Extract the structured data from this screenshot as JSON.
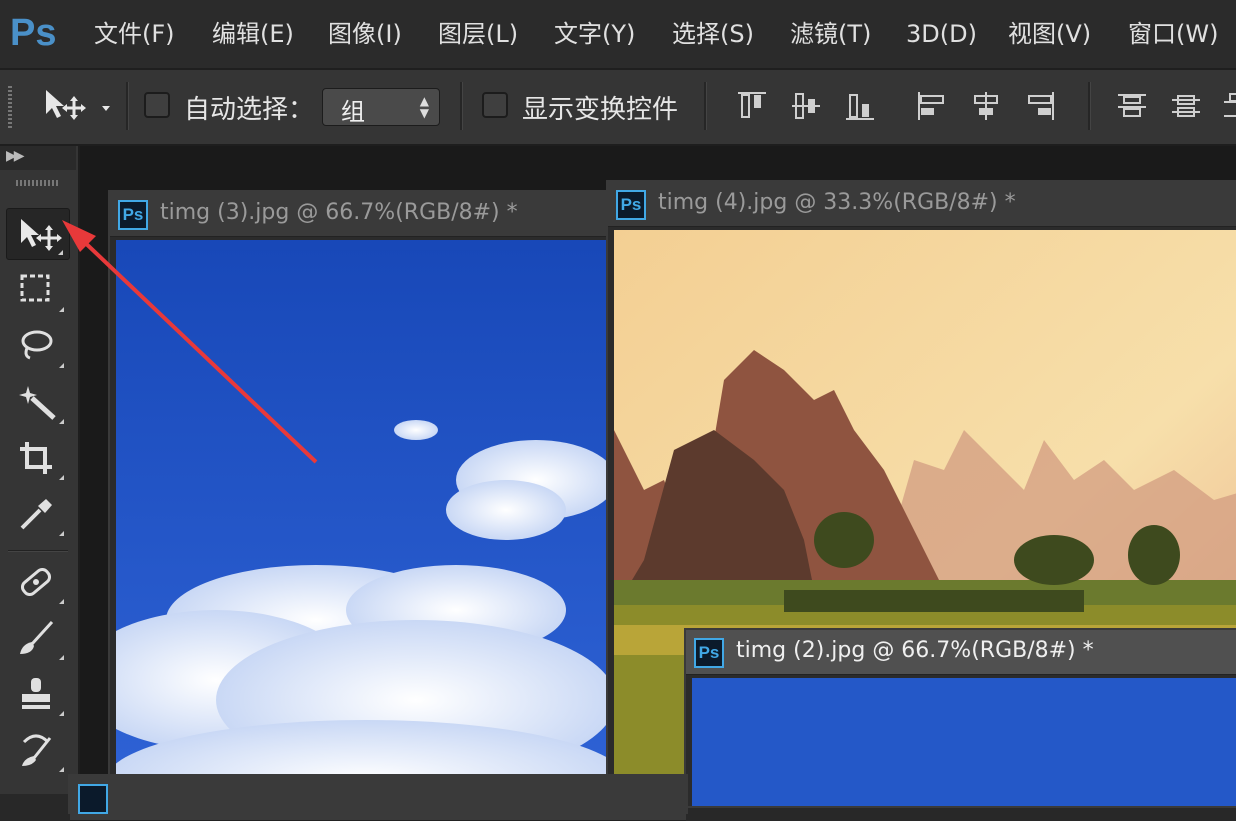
{
  "app": {
    "logo": "Ps"
  },
  "menu": [
    "文件(F)",
    "编辑(E)",
    "图像(I)",
    "图层(L)",
    "文字(Y)",
    "选择(S)",
    "滤镜(T)",
    "3D(D)",
    "视图(V)",
    "窗口(W)"
  ],
  "options": {
    "move_tool_icon": "move-tool-icon",
    "auto_select_label": "自动选择：",
    "auto_select_checked": false,
    "auto_select_target": "组",
    "show_transform_label": "显示变换控件",
    "show_transform_checked": false
  },
  "toolbar": {
    "tools": [
      "move-tool",
      "marquee-tool",
      "lasso-tool",
      "magic-wand-tool",
      "crop-tool",
      "eyedropper-tool",
      "healing-brush-tool",
      "brush-tool",
      "clone-stamp-tool",
      "history-brush-tool"
    ],
    "active_tool": "move-tool"
  },
  "documents": [
    {
      "title": "timg (3).jpg @ 66.7%(RGB/8#) *",
      "badge": "Ps"
    },
    {
      "title": "timg (4).jpg @ 33.3%(RGB/8#) *",
      "badge": "Ps"
    },
    {
      "title": "timg (2).jpg @ 66.7%(RGB/8#) *",
      "badge": "Ps"
    }
  ],
  "annotation": {
    "arrow_color": "#e8393a"
  },
  "colors": {
    "ps_blue": "#41a8e6",
    "panel": "#353535",
    "workspace": "#1a1a1a"
  }
}
